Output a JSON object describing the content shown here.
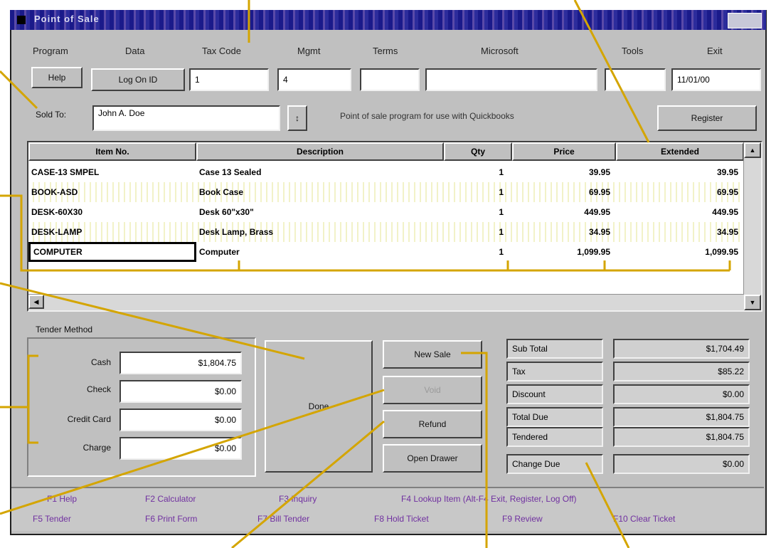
{
  "window": {
    "title": "Point of Sale"
  },
  "menu": [
    "Program",
    "Data",
    "Tax Code",
    "Mgmt",
    "Terms",
    "Microsoft",
    "Tools",
    "Exit"
  ],
  "top_row": {
    "help_label": "Help",
    "login_label": "Log On ID",
    "fields": [
      "1",
      "4",
      "",
      "",
      "",
      "11/01/00"
    ]
  },
  "sold_to": {
    "label": "Sold To:",
    "value": "John A. Doe",
    "info": "Point of sale program for use with Quickbooks",
    "register_label": "Register"
  },
  "grid": {
    "headers": [
      "Item No.",
      "Description",
      "Qty",
      "Price",
      "Extended"
    ],
    "rows": [
      [
        "CASE-13 SMPEL",
        "Case 13 Sealed",
        "1",
        "39.95",
        "39.95"
      ],
      [
        "BOOK-ASD",
        "Book Case",
        "1",
        "69.95",
        "69.95"
      ],
      [
        "DESK-60X30",
        "Desk 60\"x30\"",
        "1",
        "449.95",
        "449.95"
      ],
      [
        "DESK-LAMP",
        "Desk Lamp, Brass",
        "1",
        "34.95",
        "34.95"
      ],
      [
        "COMPUTER",
        "Computer",
        "1",
        "1,099.95",
        "1,099.95"
      ]
    ]
  },
  "tender": {
    "title": "Tender Method",
    "labels": [
      "Cash",
      "Check",
      "Credit Card",
      "Charge"
    ],
    "values": [
      "$1,804.75",
      "$0.00",
      "$0.00",
      "$0.00"
    ]
  },
  "buttons": {
    "done": "Done",
    "sale": "New Sale",
    "void": "Void",
    "refund": "Refund",
    "open_drawer": "Open Drawer"
  },
  "totals": {
    "labels": [
      "Sub Total",
      "Tax",
      "Discount",
      "Total Due",
      "Tendered",
      "Change Due"
    ],
    "values": [
      "$1,704.49",
      "$85.22",
      "$0.00",
      "$1,804.75",
      "$1,804.75",
      "$0.00"
    ]
  },
  "status": {
    "line1": [
      "F1  Help",
      "F2  Calculator",
      "F3  Inquiry",
      "F4  Lookup Item  (Alt-F4 Exit, Register, Log Off)"
    ],
    "line2": [
      "F5  Tender",
      "F6  Print Form",
      "F7  Bill Tender",
      "F8  Hold Ticket",
      "F9  Review",
      "F10  Clear Ticket"
    ]
  },
  "colors": {
    "window": "#c0c0c0",
    "titlebar": "#1a1a8a",
    "callout": "#d4a500",
    "status_text": "#7030a0"
  }
}
